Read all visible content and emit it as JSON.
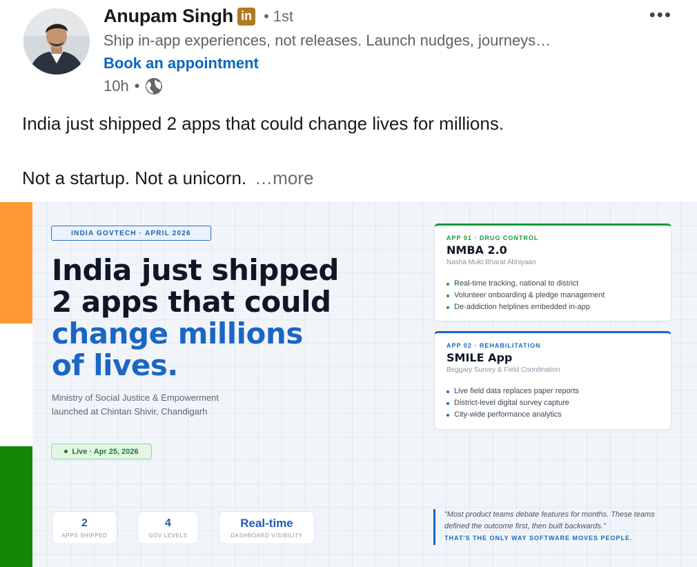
{
  "post": {
    "author_name": "Anupam Singh",
    "badge": "in",
    "degree_dot": "•",
    "degree": "1st",
    "headline": "Ship in-app experiences, not releases. Launch nudges, journeys…",
    "cta_link": "Book an appointment",
    "time": "10h",
    "time_sep": "•",
    "menu": "•••",
    "body_line_1": "India just shipped 2 apps that could change lives for millions.",
    "body_line_2": "Not a startup. Not a unicorn.",
    "see_more": "…more"
  },
  "image": {
    "tag": "INDIA GOVTECH  ·  APRIL 2026",
    "title_line_1": "India just shipped",
    "title_line_2": "2 apps that could",
    "title_line_3": "change millions",
    "title_line_4": "of lives.",
    "ministry_line_1": "Ministry of Social Justice & Empowerment",
    "ministry_line_2": "launched at Chintan Shivir, Chandigarh",
    "live_label": "Live · Apr 25, 2026",
    "stats": [
      {
        "value": "2",
        "label": "APPS SHIPPED"
      },
      {
        "value": "4",
        "label": "GOV LEVELS"
      },
      {
        "value": "Real-time",
        "label": "DASHBOARD VISIBILITY"
      }
    ],
    "apps": [
      {
        "tag": "APP 01 · DRUG CONTROL",
        "name": "NMBA 2.0",
        "subtitle": "Nasha Mukt Bharat Abhiyaan",
        "bullets": [
          "Real-time tracking, national to district",
          "Volunteer onboarding & pledge management",
          "De-addiction helplines embedded in-app"
        ]
      },
      {
        "tag": "APP 02 · REHABILITATION",
        "name": "SMILE App",
        "subtitle": "Beggary Survey & Field Coordination",
        "bullets": [
          "Live field data replaces paper reports",
          "District-level digital survey capture",
          "City-wide performance analytics"
        ]
      }
    ],
    "quote": "\"Most product teams debate features for months. These teams defined the outcome first, then built backwards.\"",
    "quote_tag": "THAT'S THE ONLY WAY SOFTWARE MOVES PEOPLE."
  },
  "colors": {
    "link_blue": "#0a66c2",
    "saffron": "#ff9933",
    "india_green": "#138808",
    "accent_blue": "#1a66c4",
    "app1_green": "#17983a"
  },
  "icons": [
    "linkedin-badge-icon",
    "globe-icon",
    "more-options-icon"
  ]
}
